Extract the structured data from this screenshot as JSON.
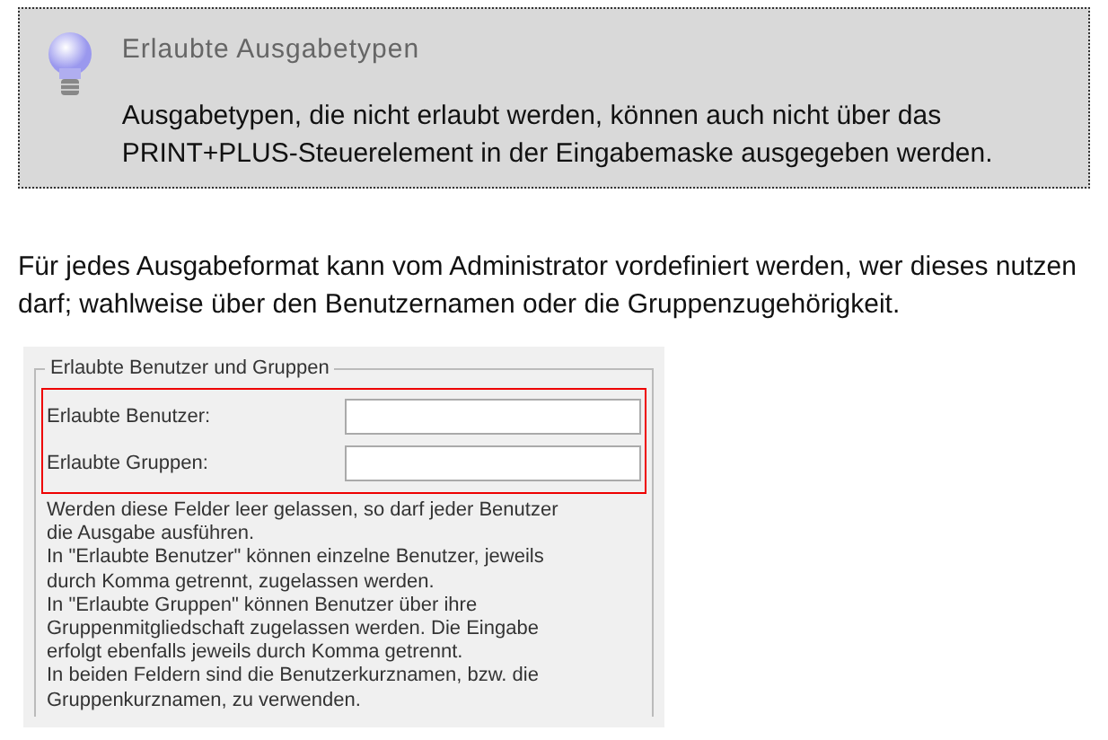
{
  "note": {
    "title": "Erlaubte Ausgabetypen",
    "text": "Ausgabetypen, die nicht erlaubt werden, können auch nicht über das PRINT+PLUS-Steuerelement in der Eingabemaske ausgegeben werden."
  },
  "paragraph": "Für jedes Ausgabeformat kann vom Administrator vordefiniert werden, wer dieses nutzen darf; wahlweise über den Benutzernamen oder die Gruppenzugehörigkeit.",
  "dialog": {
    "legend": "Erlaubte Benutzer und Gruppen",
    "fields": [
      {
        "label": "Erlaubte Benutzer:"
      },
      {
        "label": "Erlaubte Gruppen:"
      }
    ],
    "help": [
      "Werden diese Felder leer gelassen, so darf jeder Benutzer die Ausgabe ausführen.",
      "In \"Erlaubte Benutzer\" können einzelne Benutzer, jeweils durch Komma getrennt, zugelassen werden.",
      "In \"Erlaubte Gruppen\" können Benutzer über ihre Gruppenmitgliedschaft zugelassen werden. Die Eingabe erfolgt ebenfalls jeweils durch Komma getrennt.",
      "In beiden Feldern sind die Benutzerkurznamen, bzw. die Gruppenkurznamen, zu verwenden."
    ]
  }
}
